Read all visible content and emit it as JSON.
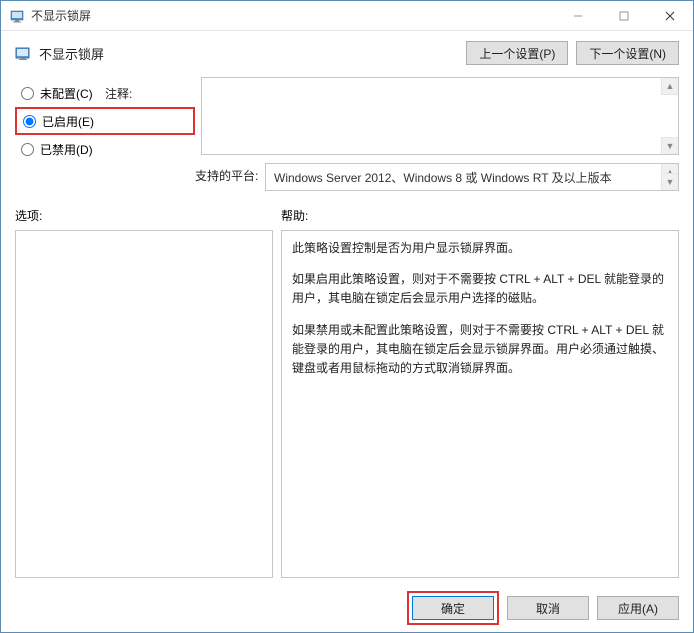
{
  "window": {
    "title": "不显示锁屏"
  },
  "header": {
    "title": "不显示锁屏",
    "prev_btn": "上一个设置(P)",
    "next_btn": "下一个设置(N)"
  },
  "radios": {
    "not_configured": "未配置(C)",
    "enabled": "已启用(E)",
    "disabled": "已禁用(D)",
    "selected": "enabled"
  },
  "meta": {
    "comment_label": "注释:",
    "comment_value": "",
    "platform_label": "支持的平台:",
    "platform_value": "Windows Server 2012、Windows 8 或 Windows RT 及以上版本"
  },
  "panes": {
    "options_label": "选项:",
    "help_label": "帮助:",
    "help_paragraphs": [
      "此策略设置控制是否为用户显示锁屏界面。",
      "如果启用此策略设置，则对于不需要按 CTRL + ALT + DEL  就能登录的用户，其电脑在锁定后会显示用户选择的磁贴。",
      "如果禁用或未配置此策略设置，则对于不需要按 CTRL + ALT + DEL 就能登录的用户，其电脑在锁定后会显示锁屏界面。用户必须通过触摸、键盘或者用鼠标拖动的方式取消锁屏界面。"
    ]
  },
  "footer": {
    "ok": "确定",
    "cancel": "取消",
    "apply": "应用(A)"
  }
}
